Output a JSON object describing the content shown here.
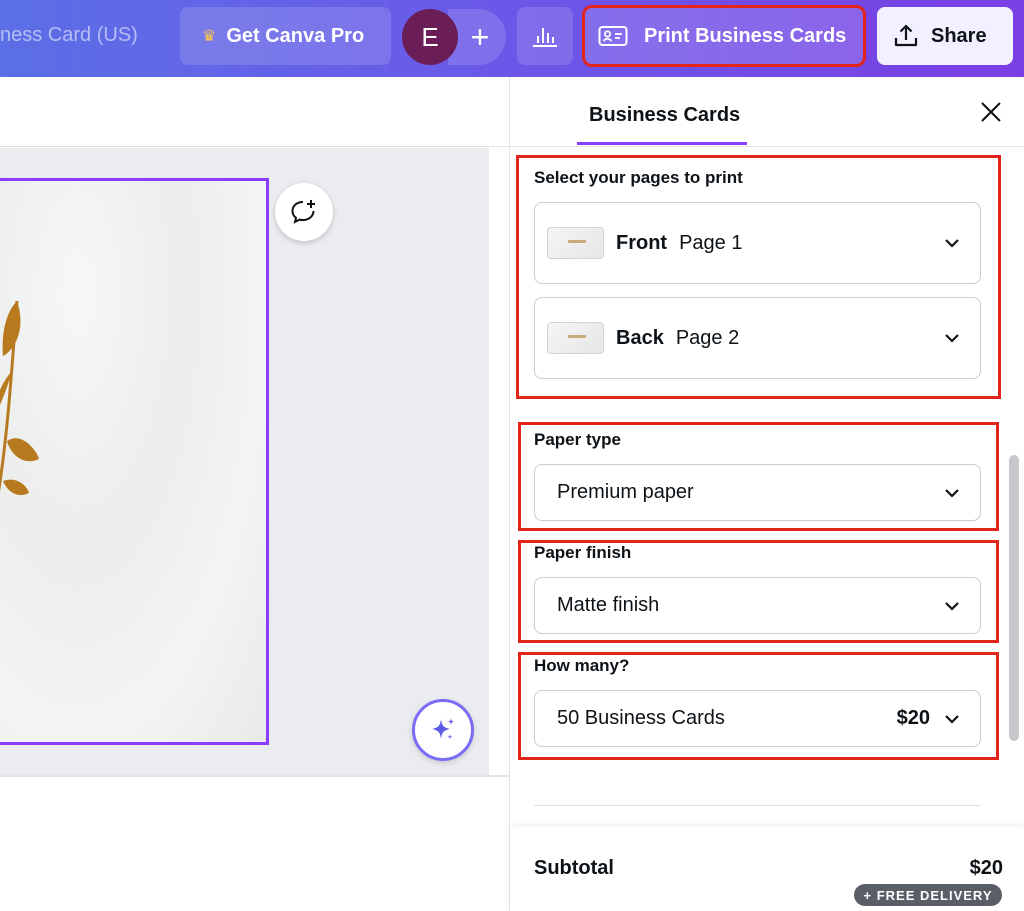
{
  "topbar": {
    "doc_title": "Business Card (US)",
    "doc_title_visible": "ness Card (US)",
    "pro_label": "Get Canva Pro",
    "avatar_initial": "E",
    "add_symbol": "+",
    "print_label": "Print Business Cards",
    "share_label": "Share"
  },
  "panel": {
    "tab_label": "Business Cards",
    "pages_label": "Select your pages to print",
    "pages": [
      {
        "side": "Front",
        "page": "Page 1"
      },
      {
        "side": "Back",
        "page": "Page 2"
      }
    ],
    "paper_type_label": "Paper type",
    "paper_type_value": "Premium paper",
    "paper_finish_label": "Paper finish",
    "paper_finish_value": "Matte finish",
    "quantity_label": "How many?",
    "quantity_value": "50 Business Cards",
    "quantity_price": "$20",
    "subtotal_label": "Subtotal",
    "subtotal_value": "$20",
    "delivery_badge": "+ FREE DELIVERY"
  },
  "icons": {
    "crown": "crown-icon",
    "add": "plus-icon",
    "stats": "bar-chart-icon",
    "print": "id-card-icon",
    "share": "upload-icon",
    "close": "close-icon",
    "comment": "comment-add-icon",
    "magic": "sparkle-icon",
    "dropdown": "chevron-down-icon"
  },
  "colors": {
    "accent": "#8b3dff",
    "highlight": "#e3241b",
    "topbar_start": "#5b6fe6",
    "topbar_end": "#7a3fe4"
  }
}
